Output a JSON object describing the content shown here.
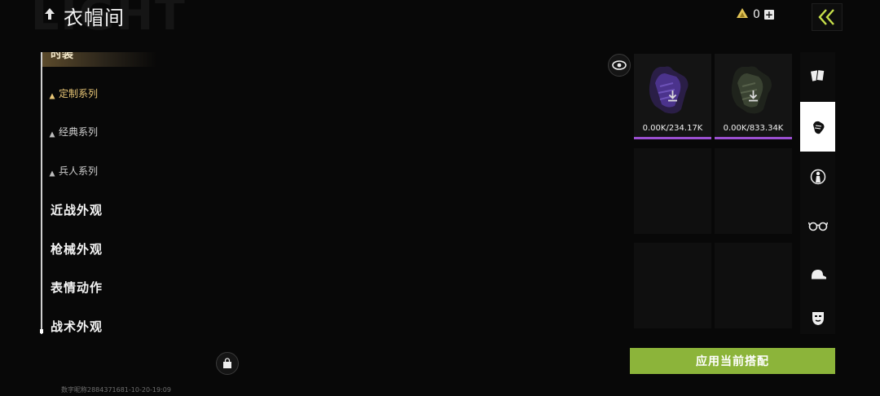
{
  "header": {
    "watermark": "LIGHT",
    "title": "衣帽间",
    "currency_value": "0",
    "currency_plus": "+"
  },
  "nav": {
    "active_tab": "时装",
    "sub_items": [
      {
        "label": "定制系列",
        "active": true
      },
      {
        "label": "经典系列",
        "active": false
      },
      {
        "label": "兵人系列",
        "active": false
      }
    ],
    "main_items": [
      {
        "label": "近战外观"
      },
      {
        "label": "枪械外观"
      },
      {
        "label": "表情动作"
      },
      {
        "label": "战术外观"
      }
    ]
  },
  "grid": {
    "items": [
      {
        "size": "0.00K/234.17K",
        "color": "#7a4fd0"
      },
      {
        "size": "0.00K/833.34K",
        "color": "#4a5a3a"
      }
    ]
  },
  "categories": [
    {
      "icon": "cards-icon",
      "active": false
    },
    {
      "icon": "glove-icon",
      "active": true
    },
    {
      "icon": "character-icon",
      "active": false
    },
    {
      "icon": "glasses-icon",
      "active": false
    },
    {
      "icon": "cap-icon",
      "active": false
    },
    {
      "icon": "mask-icon",
      "active": false
    }
  ],
  "apply_button": "应用当前搭配",
  "footer": "数字昵称2884371681-10-20-19:09",
  "colors": {
    "accent_green": "#8cb43a",
    "rarity_purple": "#9b4fd1",
    "active_gold": "#e9c777"
  }
}
